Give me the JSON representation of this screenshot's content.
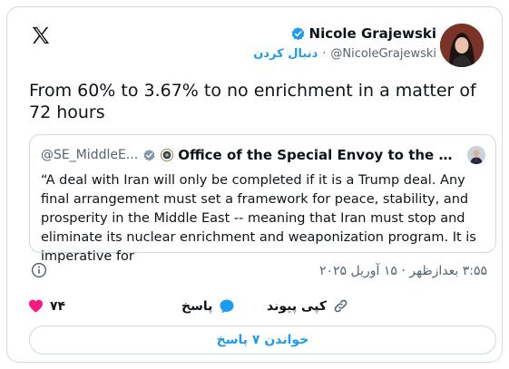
{
  "author": {
    "name": "Nicole Grajewski",
    "handle": "@NicoleGrajewski",
    "separator": "·",
    "follow_label": "دنبال کردن"
  },
  "tweet": {
    "text": "From 60% to 3.67% to no enrichment in a matter of 72 hours"
  },
  "quote": {
    "handle": "@SE_MiddleE...",
    "name": "Office of the Special Envoy to the Middl...",
    "text": "“A deal with Iran will only be completed if it is a Trump deal. Any final arrangement must set a framework for peace, stability, and prosperity in the Middle East -- meaning that Iran must stop and eliminate its nuclear enrichment and weaponization program. It is imperative for"
  },
  "meta": {
    "timestamp": "۳:۵۵ بعدازظهر · ۱۵ آوریل ۲۰۲۵"
  },
  "actions": {
    "like_count": "۷۴",
    "reply_label": "پاسخ",
    "copy_link_label": "کپی پیوند"
  },
  "read_replies_label": "خواندن ۷ پاسخ",
  "colors": {
    "accent": "#1d9bf0",
    "like": "#f91880",
    "text": "#0f1419",
    "muted": "#536471",
    "border": "#cfd9de"
  },
  "icons": [
    "x-logo-icon",
    "verified-icon",
    "government-seal-icon",
    "info-icon",
    "heart-icon",
    "reply-icon",
    "link-icon"
  ]
}
